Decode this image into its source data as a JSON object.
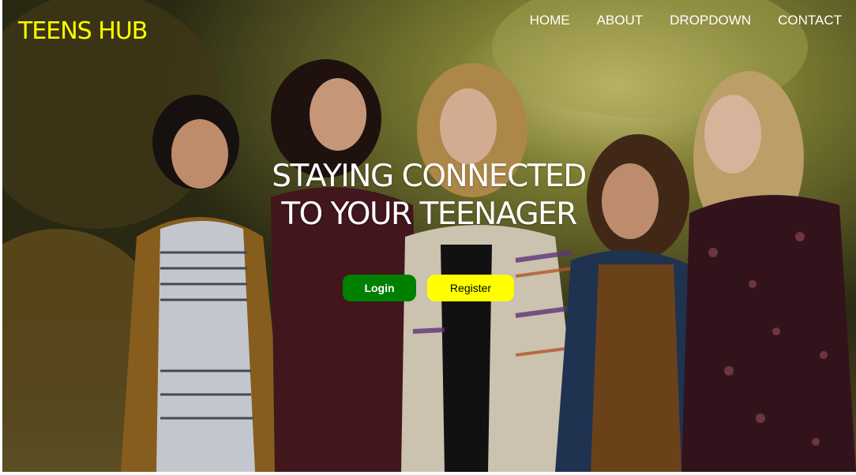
{
  "brand": "TEENS HUB",
  "nav": {
    "items": [
      "HOME",
      "ABOUT",
      "DROPDOWN",
      "CONTACT"
    ]
  },
  "hero": {
    "headline_line1": "STAYING CONNECTED",
    "headline_line2": "TO YOUR TEENAGER",
    "login_label": "Login",
    "register_label": "Register"
  },
  "colors": {
    "brand": "#ffff00",
    "login_bg": "#008000",
    "register_bg": "#ffff00"
  }
}
